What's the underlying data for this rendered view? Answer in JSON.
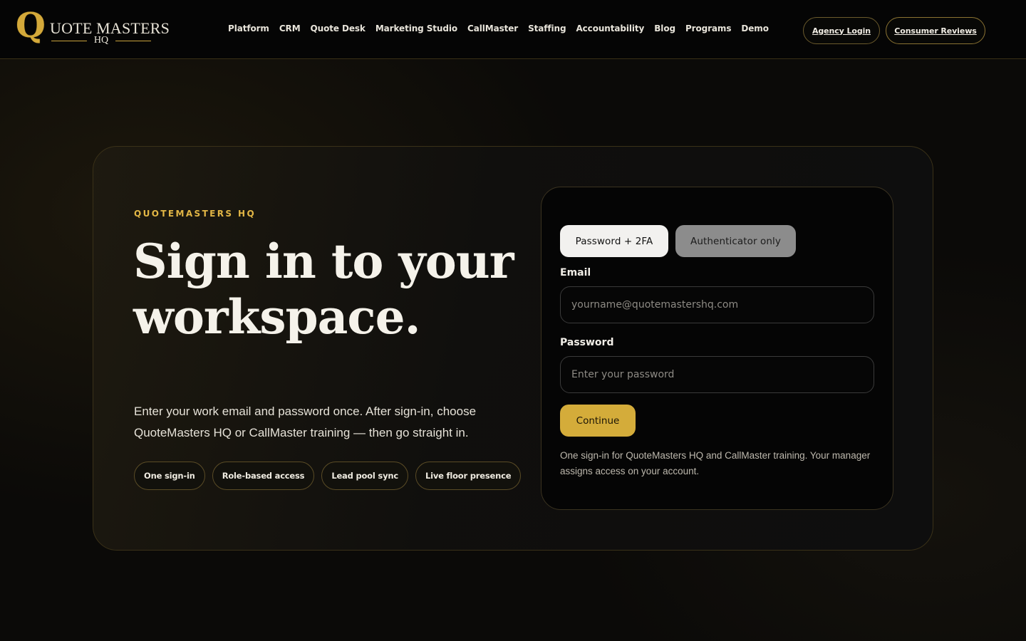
{
  "brand": {
    "logo_q": "Q",
    "logo_word": "UOTE MASTERS",
    "logo_hq": "HQ"
  },
  "nav": {
    "items": [
      {
        "label": "Platform"
      },
      {
        "label": "CRM"
      },
      {
        "label": "Quote Desk"
      },
      {
        "label": "Marketing Studio"
      },
      {
        "label": "CallMaster"
      },
      {
        "label": "Staffing"
      },
      {
        "label": "Accountability"
      },
      {
        "label": "Blog"
      },
      {
        "label": "Programs"
      },
      {
        "label": "Demo"
      }
    ],
    "agency_login": "Agency Login",
    "consumer_reviews": "Consumer Reviews"
  },
  "hero": {
    "eyebrow": "QUOTEMASTERS HQ",
    "headline": "Sign in to your workspace.",
    "lead": "Enter your work email and password once. After sign-in, choose QuoteMasters HQ or CallMaster training — then go straight in.",
    "chips": [
      {
        "label": "One sign-in"
      },
      {
        "label": "Role-based access"
      },
      {
        "label": "Lead pool sync"
      },
      {
        "label": "Live floor presence"
      }
    ]
  },
  "form": {
    "tabs": [
      {
        "label": "Password + 2FA",
        "active": true
      },
      {
        "label": "Authenticator only",
        "active": false
      }
    ],
    "email_label": "Email",
    "email_placeholder": "yourname@quotemastershq.com",
    "email_value": "",
    "password_label": "Password",
    "password_placeholder": "Enter your password",
    "password_value": "",
    "continue_label": "Continue",
    "note": "One sign-in for QuoteMasters HQ and CallMaster training. Your manager assigns access on your account."
  },
  "colors": {
    "accent_gold": "#d4ac3a",
    "eyebrow_gold": "#e2b645",
    "background": "#0b0a08"
  }
}
